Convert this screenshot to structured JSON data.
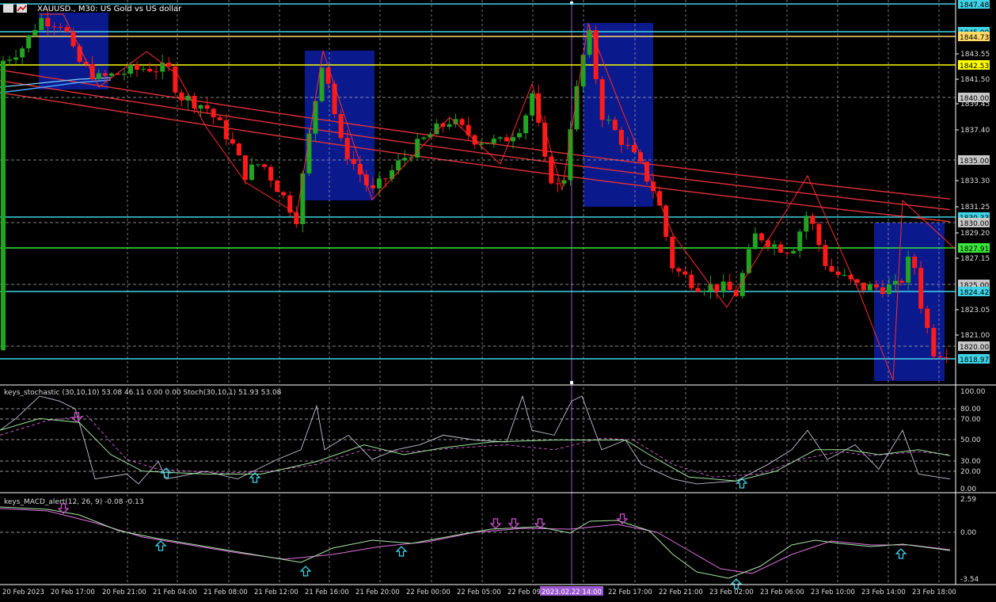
{
  "header": {
    "symbol": "XAUUSD.",
    "timeframe": "M30",
    "description": "US Gold vs US dollar",
    "title_full": "XAUUSD., M30:  US Gold vs US dollar"
  },
  "price_axis": {
    "ticks": [
      "1845.60",
      "1843.55",
      "1841.50",
      "1839.45",
      "1837.40",
      "1835.35",
      "1833.30",
      "1831.25",
      "1829.20",
      "1827.15",
      "1825.10",
      "1823.05",
      "1821.00"
    ]
  },
  "level_lines": [
    {
      "label": "1847.48",
      "color": "#3fd3e6",
      "text_color": "#000000",
      "style": "solid"
    },
    {
      "label": "1845.00",
      "color": "#3fd3e6",
      "text_color": "#000000",
      "style": "solid"
    },
    {
      "label": "1844.73",
      "color": "#ffd966",
      "text_color": "#000000",
      "style": "solid"
    },
    {
      "label": "1842.53",
      "color": "#ffff00",
      "text_color": "#000000",
      "style": "solid"
    },
    {
      "label": "1840.00",
      "color": "#b0b0b0",
      "text_color": "#000000",
      "style": "dashed"
    },
    {
      "label": "1835.00",
      "color": "#b0b0b0",
      "text_color": "#000000",
      "style": "dashed"
    },
    {
      "label": "1830.33",
      "color": "#3fd3e6",
      "text_color": "#000000",
      "style": "solid"
    },
    {
      "label": "1830.00",
      "color": "#b0b0b0",
      "text_color": "#000000",
      "style": "dashed"
    },
    {
      "label": "1827.91",
      "color": "#39e639",
      "text_color": "#000000",
      "style": "solid"
    },
    {
      "label": "1825.00",
      "color": "#b0b0b0",
      "text_color": "#000000",
      "style": "dashed"
    },
    {
      "label": "1824.42",
      "color": "#3fd3e6",
      "text_color": "#000000",
      "style": "solid"
    },
    {
      "label": "1820.00",
      "color": "#b0b0b0",
      "text_color": "#000000",
      "style": "dashed"
    },
    {
      "label": "1818.97",
      "color": "#3fd3e6",
      "text_color": "#000000",
      "style": "solid"
    }
  ],
  "stoch_panel": {
    "title": "keys_stochastic (30,10,10) 53.08 46.11 0.00 0.00 Stoch(30,10,1) 51.93 53.08",
    "ticks": [
      "100.00",
      "80.00",
      "70.00",
      "50.00",
      "30.00",
      "20.00",
      "0.00"
    ]
  },
  "macd_panel": {
    "title": "keys_MACD_alert(12, 26, 9) -0.08 -0.13",
    "ticks": [
      "2.59",
      "0.00",
      "-3.54"
    ]
  },
  "time_axis": {
    "labels": [
      "20 Feb 2023",
      "20 Feb 17:00",
      "20 Feb 21:00",
      "21 Feb 04:00",
      "21 Feb 08:00",
      "21 Feb 12:00",
      "21 Feb 16:00",
      "21 Feb 20:00",
      "22 Feb 00:00",
      "22 Feb 05:00",
      "22 Feb 09:",
      "22 Feb 17:00",
      "22 Feb 21:00",
      "23 Feb 02:00",
      "23 Feb 06:00",
      "23 Feb 10:00",
      "23 Feb 14:00",
      "23 Feb 18:00"
    ],
    "crosshair_label": "2023.02.22 14:00"
  },
  "colors": {
    "background": "#000000",
    "bull": "#22a322",
    "bear": "#ff1a1a",
    "zone": "#0a1a8c",
    "ma": "#e0303a",
    "zigzag": "#ff2a2a",
    "grid": "#c8c8c8",
    "crosshair": "#9b59d0",
    "arrow_up": "#3fd3e6",
    "arrow_down": "#d050d0"
  }
}
